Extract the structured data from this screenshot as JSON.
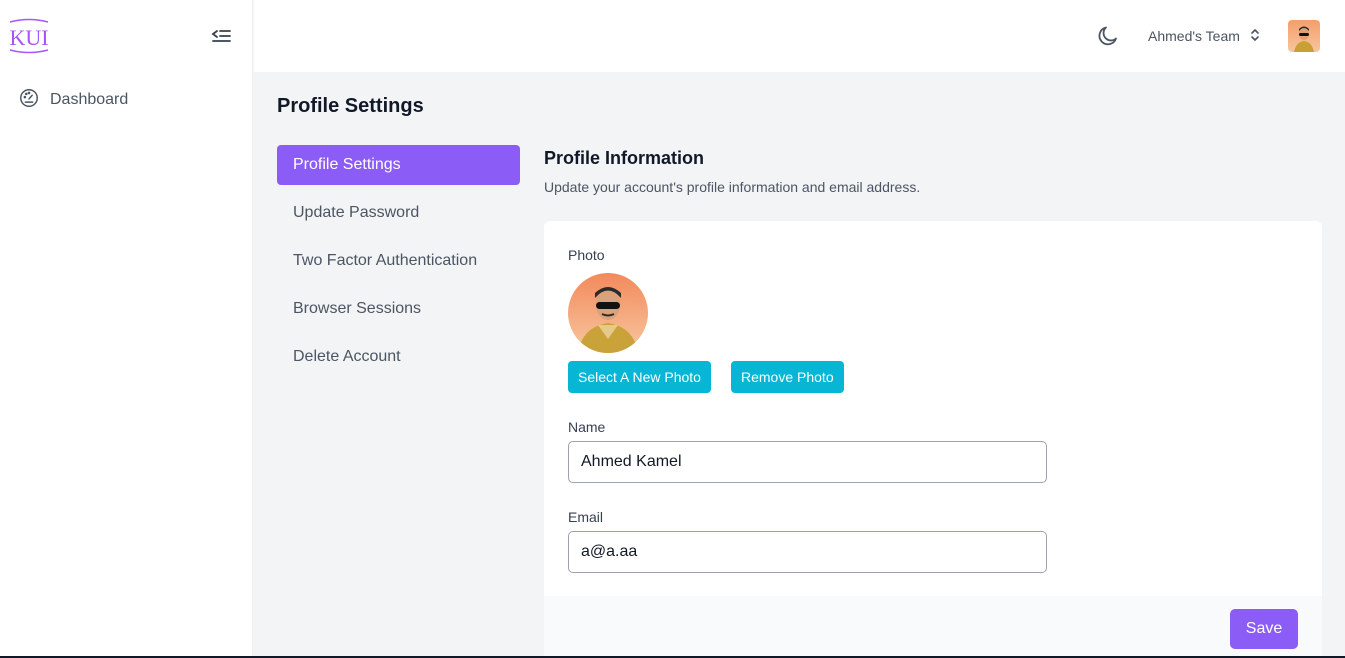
{
  "sidebar": {
    "logo_text": "KUI",
    "items": [
      {
        "label": "Dashboard",
        "icon": "gauge-icon"
      }
    ]
  },
  "topbar": {
    "team_name": "Ahmed's Team"
  },
  "page": {
    "title": "Profile Settings"
  },
  "settings_nav": [
    {
      "label": "Profile Settings",
      "active": true
    },
    {
      "label": "Update Password",
      "active": false
    },
    {
      "label": "Two Factor Authentication",
      "active": false
    },
    {
      "label": "Browser Sessions",
      "active": false
    },
    {
      "label": "Delete Account",
      "active": false
    }
  ],
  "profile": {
    "section_title": "Profile Information",
    "section_desc": "Update your account's profile information and email address.",
    "photo_label": "Photo",
    "select_photo_label": "Select A New Photo",
    "remove_photo_label": "Remove Photo",
    "name_label": "Name",
    "name_value": "Ahmed Kamel",
    "email_label": "Email",
    "email_value": "a@a.aa",
    "save_label": "Save"
  },
  "colors": {
    "accent": "#8b5cf6",
    "cyan": "#06b6d4"
  }
}
